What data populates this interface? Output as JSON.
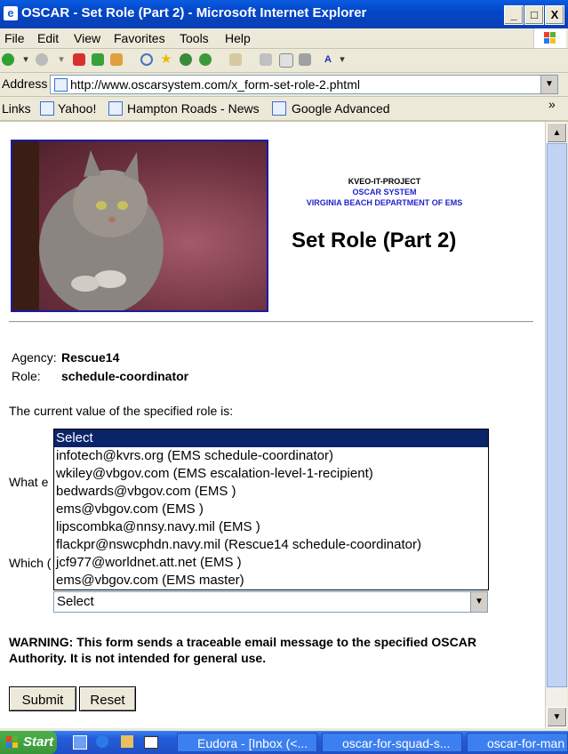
{
  "window": {
    "title": "OSCAR - Set Role (Part 2) - Microsoft Internet Explorer",
    "minimize": "_",
    "maximize": "□",
    "close": "X"
  },
  "menu": [
    "File",
    "Edit",
    "View",
    "Favorites",
    "Tools",
    "Help"
  ],
  "address": {
    "label": "Address",
    "url": "http://www.oscarsystem.com/x_form-set-role-2.phtml"
  },
  "links": {
    "label": "Links",
    "items": [
      "Yahoo!",
      "Hampton Roads - News",
      "Google Advanced"
    ],
    "more": "»"
  },
  "page": {
    "project_line1": "KVEO-IT-PROJECT",
    "project_line2": "OSCAR SYSTEM",
    "project_line3": "VIRGINIA BEACH DEPARTMENT OF EMS",
    "title": "Set Role (Part 2)",
    "agency_label": "Agency:",
    "agency_value": "Rescue14",
    "role_label": "Role:",
    "role_value": "schedule-coordinator",
    "current_value_text": "The current value of the specified role is:",
    "what_label_partial": "What e",
    "which_label_partial": "Which (",
    "listbox_options": [
      "Select",
      "infotech@kvrs.org (EMS schedule-coordinator)",
      "wkiley@vbgov.com (EMS escalation-level-1-recipient)",
      "bedwards@vbgov.com (EMS )",
      "ems@vbgov.com (EMS )",
      "lipscombka@nnsy.navy.mil (EMS )",
      "flackpr@nswcphdn.navy.mil (Rescue14 schedule-coordinator)",
      "jcf977@worldnet.att.net (EMS )",
      "ems@vbgov.com (EMS master)"
    ],
    "select_value": "Select",
    "warning": "WARNING:  This form sends a traceable email message to the specified OSCAR Authority.  It is not intended for general use.",
    "submit_label": "Submit",
    "reset_label": "Reset"
  },
  "taskbar": {
    "start": "Start",
    "items": [
      "Eudora - [Inbox (<...",
      "oscar-for-squad-s...",
      "oscar-for-man"
    ]
  }
}
